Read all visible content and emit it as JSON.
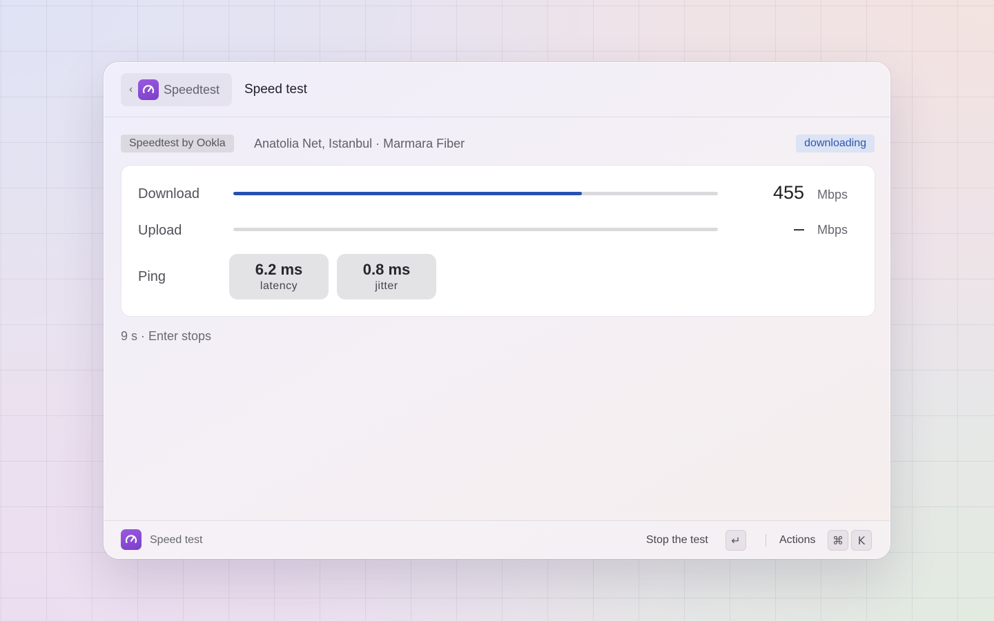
{
  "header": {
    "back_label": "Speedtest",
    "title": "Speed test"
  },
  "meta": {
    "provider_badge": "Speedtest by Ookla",
    "server": "Anatolia Net, Istanbul · Marmara Fiber",
    "status": "downloading"
  },
  "results": {
    "download": {
      "label": "Download",
      "value": "455",
      "unit": "Mbps",
      "progress": 0.72
    },
    "upload": {
      "label": "Upload",
      "value": "–",
      "unit": "Mbps",
      "progress": 0
    },
    "ping": {
      "label": "Ping",
      "latency": {
        "value": "6.2 ms",
        "label": "latency"
      },
      "jitter": {
        "value": "0.8 ms",
        "label": "jitter"
      }
    }
  },
  "hint": "9 s · Enter stops",
  "footer": {
    "title": "Speed test",
    "primary_action": "Stop the test",
    "primary_key": "↵",
    "actions_label": "Actions",
    "actions_keys": [
      "⌘",
      "K"
    ]
  },
  "colors": {
    "accent": "#2552b0",
    "app_icon": "#8b4fd6",
    "status_text": "#2f56ad",
    "status_bg": "#dbe3f5"
  },
  "icons": {
    "app": "speedometer-icon",
    "back": "chevron-left-icon"
  }
}
